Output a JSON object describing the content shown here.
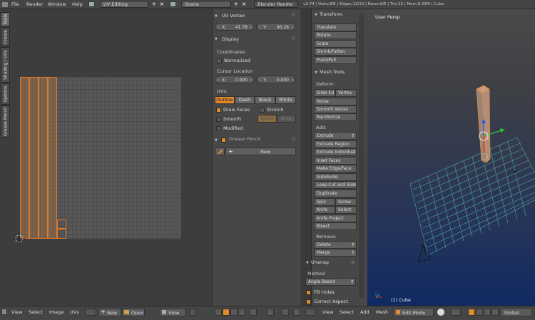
{
  "topbar": {
    "menus": [
      "File",
      "Render",
      "Window",
      "Help"
    ],
    "layout": "UV Editing",
    "scene": "Scene",
    "engine": "Blender Render",
    "stats": "v2.74 | Verts:8/8 | Edges:12/12 | Faces:6/6 | Tris:12 | Mem:9.25M | Cube"
  },
  "props": {
    "uv_vertex": {
      "title": "UV Vertex",
      "x_label": "X:",
      "x": "41.78",
      "y_label": "Y:",
      "y": "90.26"
    },
    "display": {
      "title": "Display",
      "coordinates": "Coordinates:",
      "normalized": "Normalized",
      "cursor_location": "Cursor Location",
      "cx_label": "X:",
      "cx": "0.000",
      "cy_label": "Y:",
      "cy": "0.000",
      "uvs": "UVs:",
      "outline": "Outline",
      "dash": "Dash",
      "black": "Black",
      "white": "White",
      "draw_faces": "Draw Faces",
      "stretch": "Stretch",
      "smooth": "Smooth",
      "angle": "Angle",
      "area": "Area",
      "modified": "Modified"
    },
    "grease": {
      "title": "Grease Pencil",
      "new": "New"
    }
  },
  "tabs": [
    "Tools",
    "Create",
    "Shading / UVs",
    "Options",
    "Grease Pencil"
  ],
  "tools": {
    "transform": {
      "title": "Transform",
      "items": [
        "Translate",
        "Rotate",
        "Scale",
        "Shrink/Fatten",
        "Push/Pull"
      ]
    },
    "mesh_tools": {
      "title": "Mesh Tools",
      "deform": "Deform:",
      "slide_edge": "Slide Ed",
      "vertex": "Vertex",
      "noise": "Noise",
      "smooth_vertex": "Smooth Vertex",
      "randomize": "Randomize",
      "add": "Add:",
      "extrude": "Extrude",
      "add_items": [
        "Extrude Region",
        "Extrude Individual",
        "Inset Faces",
        "Make Edge/Face",
        "Subdivide",
        "Loop Cut and Slide",
        "Duplicate"
      ],
      "spin": "Spin",
      "screw": "Screw",
      "knife": "Knife",
      "select": "Select",
      "knife_project": "Knife Project",
      "bisect": "Bisect",
      "remove": "Remove:",
      "delete": "Delete",
      "merge": "Merge"
    },
    "unwrap": {
      "title": "Unwrap",
      "method": "Method",
      "method_value": "Angle Based",
      "fill_holes": "Fill Holes",
      "correct_aspect": "Correct Aspect"
    }
  },
  "viewport": {
    "label": "User Persp",
    "object": "(1) Cube"
  },
  "bottombar": {
    "left": [
      "View",
      "Select",
      "Image",
      "UVs"
    ],
    "new": "New",
    "open": "Open",
    "view_sel": "View",
    "right": [
      "View",
      "Select",
      "Add",
      "Mesh"
    ],
    "mode": "Edit Mode",
    "orient": "Global"
  },
  "colors": {
    "accent": "#e08b2e",
    "grid": "#4fa8a0"
  }
}
